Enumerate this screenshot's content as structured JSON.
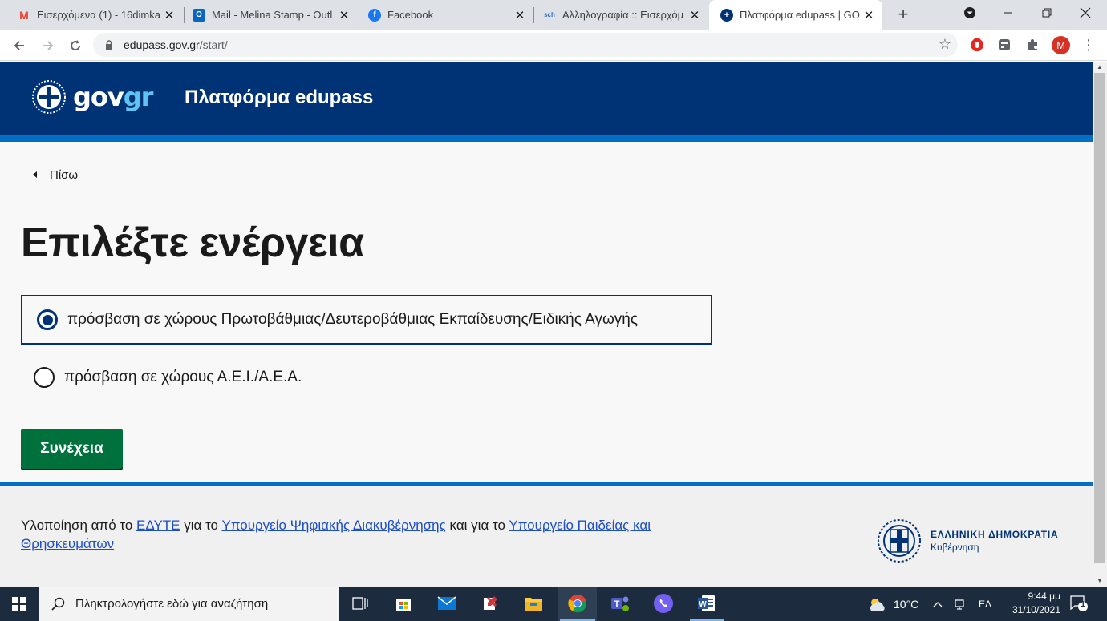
{
  "browser": {
    "tabs": [
      {
        "title": "Εισερχόμενα (1) - 16dimka",
        "favicon": "gmail-icon",
        "active": false
      },
      {
        "title": "Mail - Melina Stamp - Outl",
        "favicon": "outlook-icon",
        "active": false
      },
      {
        "title": "Facebook",
        "favicon": "facebook-icon",
        "active": false
      },
      {
        "title": "Αλληλογραφία :: Εισερχόμ",
        "favicon": "webmail-icon",
        "active": false
      },
      {
        "title": "Πλατφόρμα edupass | GO",
        "favicon": "gov-icon",
        "active": true
      }
    ],
    "new_tab": "+",
    "url_host": "edupass.gov.gr",
    "url_path": "/start/",
    "profile_initial": "M"
  },
  "header": {
    "logo_gov": "gov",
    "logo_gr": "gr",
    "title": "Πλατφόρμα edupass"
  },
  "back_link": "Πίσω",
  "page_title": "Επιλέξτε ενέργεια",
  "options": [
    {
      "label": "πρόσβαση σε χώρους Πρωτοβάθμιας/Δευτεροβάθμιας Εκπαίδευσης/Ειδικής Αγωγής",
      "selected": true
    },
    {
      "label": "πρόσβαση σε χώρους Α.Ε.Ι./Α.Ε.Α.",
      "selected": false
    }
  ],
  "continue_label": "Συνέχεια",
  "footer": {
    "text_1": "Υλοποίηση από το ",
    "link_1": "ΕΔΥΤΕ",
    "text_2": " για το ",
    "link_2": "Υπουργείο Ψηφιακής Διακυβέρνησης",
    "text_3": " και για το ",
    "link_3": "Υπουργείο Παιδείας και Θρησκευμάτων",
    "logo_line1": "ΕΛΛΗΝΙΚΗ ΔΗΜΟΚΡΑΤΙΑ",
    "logo_line2": "Κυβέρνηση"
  },
  "taskbar": {
    "search_placeholder": "Πληκτρολογήστε εδώ για αναζήτηση",
    "temperature": "10°C",
    "language": "ΕΛ",
    "time": "9:44 μμ",
    "date": "31/10/2021",
    "notification_count": "1"
  },
  "colors": {
    "header_blue": "#003375",
    "accent_blue": "#046ec5",
    "button_green": "#00703c"
  }
}
